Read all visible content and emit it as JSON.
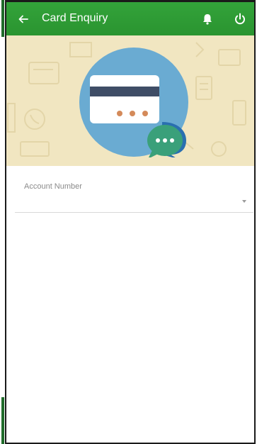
{
  "appbar": {
    "title": "Card Enquiry",
    "back_icon": "arrow-left-icon",
    "notification_icon": "bell-icon",
    "logout_icon": "power-icon",
    "color": "#2e9c34"
  },
  "hero": {
    "background_color": "#f1e6c1",
    "illustration": "card-with-chat-bubble"
  },
  "form": {
    "account_number": {
      "label": "Account Number",
      "value": ""
    }
  }
}
